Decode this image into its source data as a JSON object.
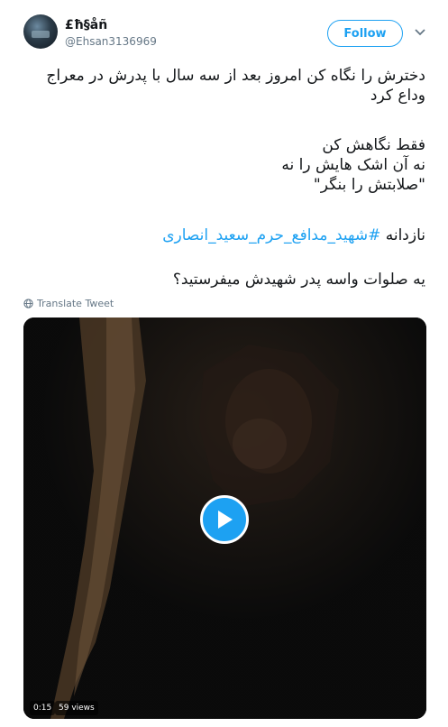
{
  "user": {
    "name": "£ħ§åñ",
    "handle": "@Ehsan3136969"
  },
  "follow_label": "Follow",
  "tweet": {
    "line1": "دخترش را نگاه کن امروز بعد از سه سال با پدرش در معراج",
    "line2": "وداع کرد",
    "line3": "فقط نگاهش کن",
    "line4": "نه آن اشک هایش را نه",
    "line5": "\"صلابتش را بنگر\"",
    "line6_prefix": "نازدانه ",
    "hashtag": "#شهید_مدافع_حرم_سعید_انصاری",
    "line7": "یه صلوات واسه پدر شهیدش میفرستید؟"
  },
  "translate_label": "Translate Tweet",
  "video": {
    "duration": "0:15",
    "views": "59 views"
  },
  "colors": {
    "accent": "#1da1f2",
    "text": "#14171a",
    "muted": "#657786"
  },
  "icons": [
    "avatar",
    "chevron-down-icon",
    "globe-icon",
    "play-icon"
  ]
}
